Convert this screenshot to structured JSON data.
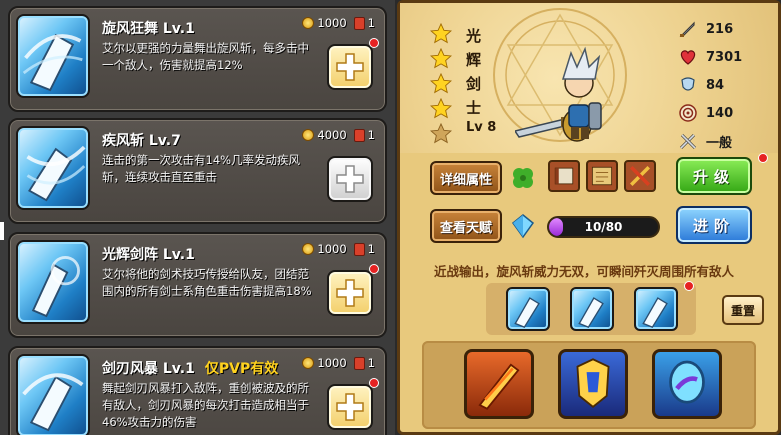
{
  "skills": [
    {
      "name": "旋风狂舞 Lv.1",
      "pvp_tag": "",
      "description": "艾尔以更强的力量舞出旋风斩，每多击中一个敌人，伤害就提高12%",
      "gold_cost": "1000",
      "scroll_cost": "1",
      "plus_style": "gold",
      "has_alert": true
    },
    {
      "name": "疾风斩 Lv.7",
      "pvp_tag": "",
      "description": "连击的第一次攻击有14%几率发动疾风斩，连续攻击直至重击",
      "gold_cost": "4000",
      "scroll_cost": "1",
      "plus_style": "grey",
      "has_alert": false
    },
    {
      "name": "光辉剑阵 Lv.1",
      "pvp_tag": "",
      "description": "艾尔将他的剑术技巧传授给队友，团结范围内的所有剑士系角色重击伤害提高18%",
      "gold_cost": "1000",
      "scroll_cost": "1",
      "plus_style": "gold",
      "has_alert": true
    },
    {
      "name": "剑刃风暴 Lv.1",
      "pvp_tag": "仅PVP有效",
      "description": "舞起剑刃风暴打入敌阵，重创被波及的所有敌人，剑刃风暴的每次打击造成相当于46%攻击力的伤害",
      "gold_cost": "1000",
      "scroll_cost": "1",
      "plus_style": "gold",
      "has_alert": true
    }
  ],
  "hero": {
    "title_chars": [
      "光",
      "辉",
      "剑",
      "士"
    ],
    "level": "Lv 8",
    "stars_filled": 4,
    "stars_total": 5,
    "stats": {
      "attack": "216",
      "hp": "7301",
      "defense": "84",
      "crit": "140",
      "weapon_type": "一般"
    }
  },
  "buttons": {
    "details": "详细属性",
    "upgrade": "升级",
    "talent": "查看天赋",
    "advance": "进阶",
    "reset": "重置"
  },
  "xp": {
    "text": "10/80",
    "fraction": 0.125
  },
  "hero_summary": "近战输出，旋风斩威力无双，可瞬间歼灭周围所有敌人",
  "colors": {
    "accent_gold": "#f3cf6a",
    "upgrade_green": "#33a614",
    "advance_blue": "#2a78d8",
    "xp_purple": "#9a2ad8",
    "alert_red": "#e62222",
    "pvp_yellow": "#ffd21e"
  },
  "icons": {
    "attack": "sword-icon",
    "hp": "heart-icon",
    "defense": "shield-icon",
    "crit": "target-icon",
    "weapon": "crossed-swords-icon"
  }
}
